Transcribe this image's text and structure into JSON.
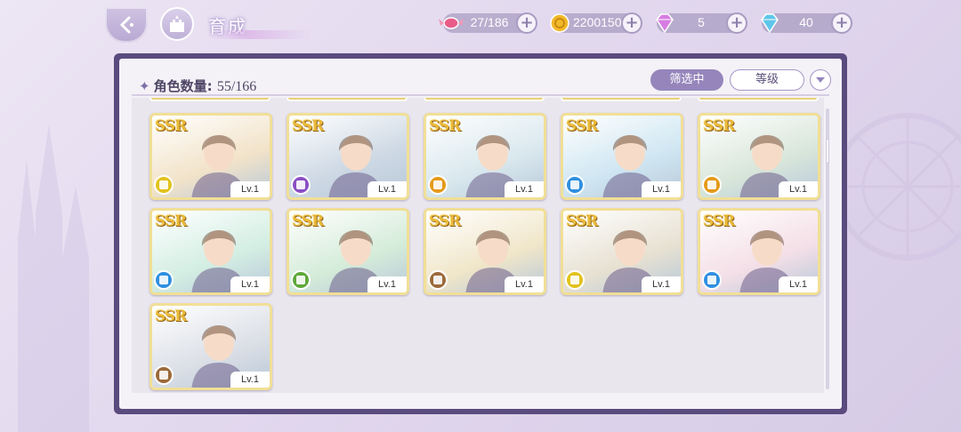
{
  "header": {
    "title": "育成",
    "back_icon": "back-arrow-icon",
    "home_icon": "castle-icon"
  },
  "resources": [
    {
      "name": "candy",
      "icon": "candy-icon",
      "value": "27/186",
      "color": "#e95c8a"
    },
    {
      "name": "gold",
      "icon": "gold-coin-icon",
      "value": "2200150",
      "color": "#f2b82a"
    },
    {
      "name": "pink-gem",
      "icon": "pink-diamond-icon",
      "value": "5",
      "color": "#d77de2"
    },
    {
      "name": "blue-gem",
      "icon": "blue-diamond-icon",
      "value": "40",
      "color": "#5fc6ea"
    }
  ],
  "panel": {
    "count_label": "角色数量:",
    "count_value": "55/166",
    "filter_label": "筛选中",
    "sort_label": "等级",
    "sort_dir_icon": "chevron-down-icon"
  },
  "cards": [
    {
      "rarity": "SSR",
      "level": "Lv.1",
      "role_color": "#e2c21e",
      "bg": "#f2e3c9",
      "new": true
    },
    {
      "rarity": "SSR",
      "level": "Lv.1",
      "role_color": "#8a4fc4",
      "bg": "#cdd8e4",
      "new": true
    },
    {
      "rarity": "SSR",
      "level": "Lv.1",
      "role_color": "#e49a1a",
      "bg": "#d9e8ee",
      "new": false
    },
    {
      "rarity": "SSR",
      "level": "Lv.1",
      "role_color": "#2f8fe0",
      "bg": "#cfe6f2",
      "new": true
    },
    {
      "rarity": "SSR",
      "level": "Lv.1",
      "role_color": "#e49a1a",
      "bg": "#d8e6da",
      "new": false
    },
    {
      "rarity": "SSR",
      "level": "Lv.1",
      "role_color": "#2f8fe0",
      "bg": "#d3eee3",
      "new": true
    },
    {
      "rarity": "SSR",
      "level": "Lv.1",
      "role_color": "#5ea83a",
      "bg": "#d5ecd9",
      "new": true
    },
    {
      "rarity": "SSR",
      "level": "Lv.1",
      "role_color": "#9b6a3a",
      "bg": "#f0e6c9",
      "new": false
    },
    {
      "rarity": "SSR",
      "level": "Lv.1",
      "role_color": "#e2c21e",
      "bg": "#e7e1d2",
      "new": false
    },
    {
      "rarity": "SSR",
      "level": "Lv.1",
      "role_color": "#2f8fe0",
      "bg": "#f4dfe7",
      "new": true
    },
    {
      "rarity": "SSR",
      "level": "Lv.1",
      "role_color": "#9b6a3a",
      "bg": "#dbdfe6",
      "new": true
    }
  ]
}
